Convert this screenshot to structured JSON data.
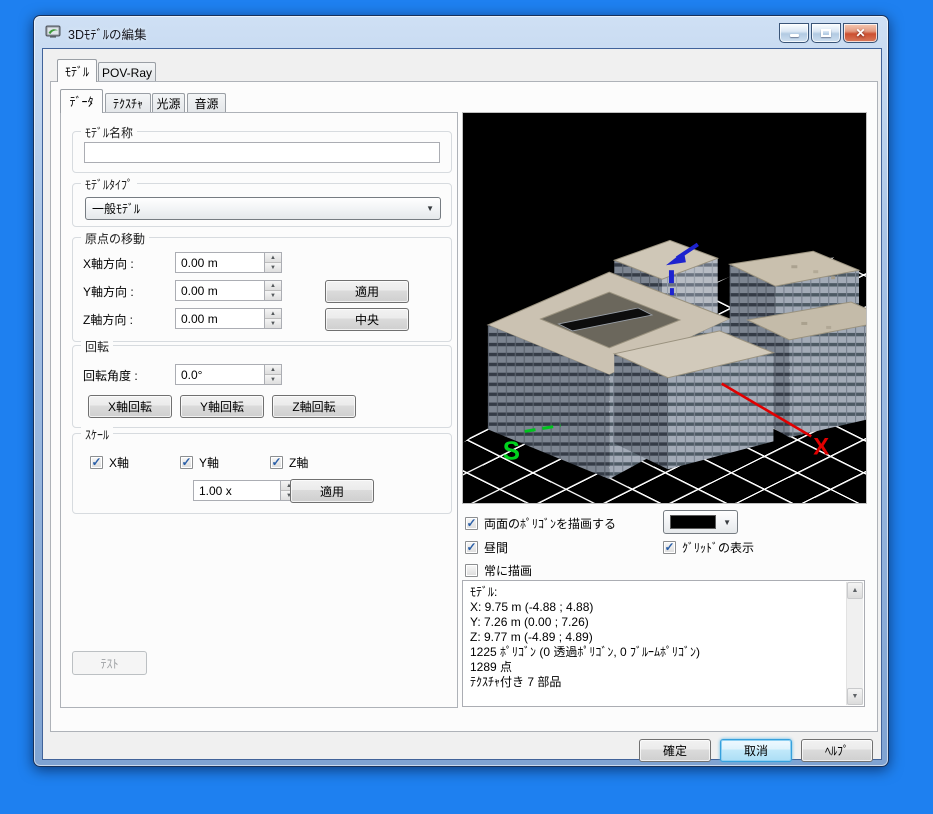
{
  "window": {
    "title": "3Dﾓﾃﾞﾙの編集"
  },
  "icons": {
    "app": "3d-model-app-icon",
    "minimize": "minimize-icon",
    "maximize": "maximize-icon",
    "close": "✕",
    "check": "✓",
    "dropdown": "▼",
    "spin_up": "▲",
    "spin_down": "▼",
    "scroll_up": "▲",
    "scroll_down": "▼"
  },
  "tabs": {
    "main": [
      {
        "label": "ﾓﾃﾞﾙ",
        "active": true
      },
      {
        "label": "POV-Ray",
        "active": false
      }
    ],
    "sub": [
      {
        "label": "ﾃﾞｰﾀ",
        "active": true
      },
      {
        "label": "ﾃｸｽﾁｬ",
        "active": false
      },
      {
        "label": "光源",
        "active": false
      },
      {
        "label": "音源",
        "active": false
      }
    ]
  },
  "model_name": {
    "legend": "ﾓﾃﾞﾙ名称",
    "value": ""
  },
  "model_type": {
    "legend": "ﾓﾃﾞﾙﾀｲﾌﾟ",
    "selected": "一般ﾓﾃﾞﾙ"
  },
  "origin": {
    "legend": "原点の移動",
    "x_label": "X軸方向 :",
    "x_value": "0.00 m",
    "y_label": "Y軸方向 :",
    "y_value": "0.00 m",
    "z_label": "Z軸方向 :",
    "z_value": "0.00 m",
    "apply": "適用",
    "center": "中央"
  },
  "rotation": {
    "legend": "回転",
    "angle_label": "回転角度 :",
    "angle_value": "0.0°",
    "rotate_x": "X軸回転",
    "rotate_y": "Y軸回転",
    "rotate_z": "Z軸回転"
  },
  "scale": {
    "legend": "ｽｹｰﾙ",
    "x_label": "X軸",
    "x_checked": true,
    "y_label": "Y軸",
    "y_checked": true,
    "z_label": "Z軸",
    "z_checked": true,
    "value": "1.00 x",
    "apply": "適用"
  },
  "test": {
    "label": "ﾃｽﾄ",
    "enabled": false
  },
  "display": {
    "both_faces": {
      "label": "両面のﾎﾟﾘｺﾞﾝを描画する",
      "checked": true
    },
    "daytime": {
      "label": "昼間",
      "checked": true
    },
    "always_draw": {
      "label": "常に描画",
      "checked": false
    },
    "grid": {
      "label": "ｸﾞﾘｯﾄﾞの表示",
      "checked": true
    },
    "polygon_color": "#000000"
  },
  "viewport": {
    "background": "#000000",
    "grid_color": "#ffffff",
    "x_axis_label": "X",
    "x_axis_color": "#e10000",
    "south_label": "S",
    "south_color": "#00d21e",
    "y_axis_color": "#1d23cf"
  },
  "info": {
    "lines": [
      "ﾓﾃﾞﾙ:",
      "X: 9.75 m (-4.88 ; 4.88)",
      "Y: 7.26 m (0.00 ; 7.26)",
      "Z: 9.77 m (-4.89 ; 4.89)",
      "1225 ﾎﾟﾘｺﾞﾝ (0 透過ﾎﾟﾘｺﾞﾝ, 0 ﾌﾞﾙｰﾑﾎﾟﾘｺﾞﾝ)",
      "1289 点",
      "ﾃｸｽﾁｬ付き 7 部品"
    ]
  },
  "footer": {
    "ok": "確定",
    "cancel": "取消",
    "help": "ﾍﾙﾌﾟ"
  }
}
